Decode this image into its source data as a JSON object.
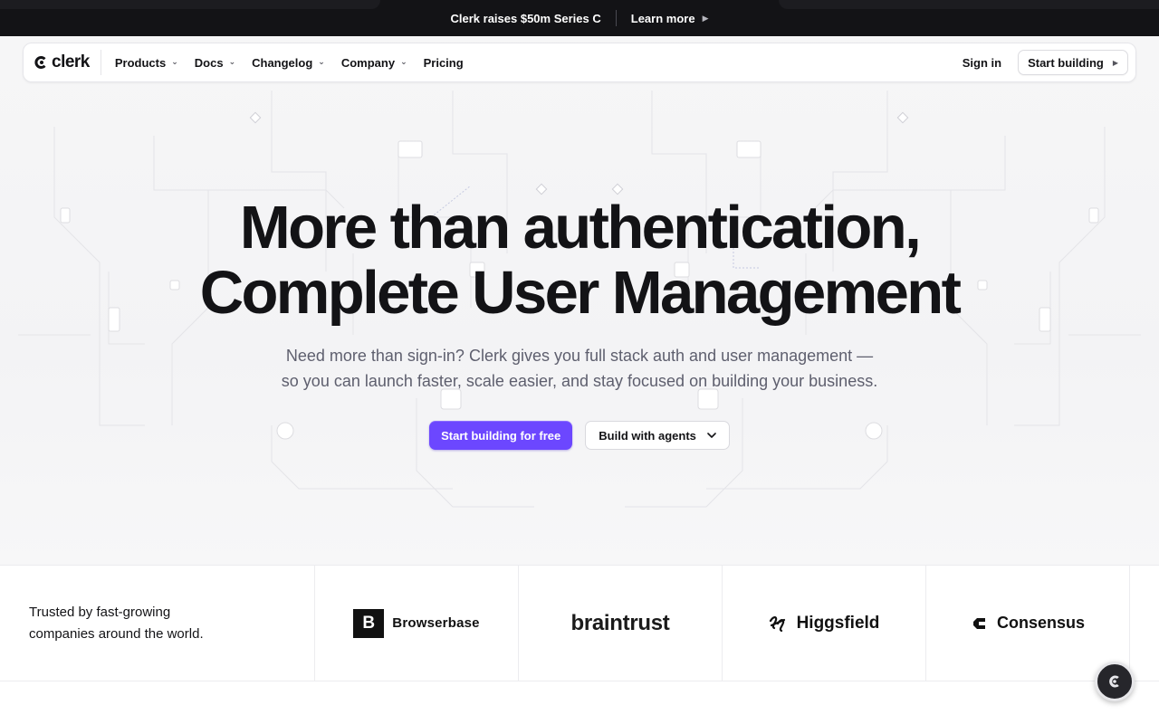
{
  "announcement": {
    "text": "Clerk raises $50m Series C",
    "link_label": "Learn more"
  },
  "nav": {
    "logo_text": "clerk",
    "items": [
      {
        "label": "Products",
        "has_dropdown": true
      },
      {
        "label": "Docs",
        "has_dropdown": true
      },
      {
        "label": "Changelog",
        "has_dropdown": true
      },
      {
        "label": "Company",
        "has_dropdown": true
      },
      {
        "label": "Pricing",
        "has_dropdown": false
      }
    ],
    "sign_in": "Sign in",
    "start_building": "Start building"
  },
  "hero": {
    "headline_line1": "More than authentication,",
    "headline_line2": "Complete User Management",
    "subtitle_line1": "Need more than sign-in? Clerk gives you full stack auth and user management —",
    "subtitle_line2": "so you can launch faster, scale easier, and stay focused on building your business.",
    "cta_primary": "Start building for free",
    "cta_secondary": "Build with agents"
  },
  "trust": {
    "text_line1": "Trusted by fast-growing",
    "text_line2": "companies around the world.",
    "logos": [
      {
        "mark": "B",
        "name": "Browserbase"
      },
      {
        "name": "braintrust"
      },
      {
        "name": "Higgsfield"
      },
      {
        "name": "Consensus"
      }
    ]
  },
  "colors": {
    "accent": "#6c47ff",
    "announcement_bg": "#131316",
    "text_primary": "#131316",
    "text_secondary": "#5e5f6e"
  },
  "icons": {
    "nav_dropdown": "chevron-down-icon",
    "start_building": "play-triangle-icon",
    "announcement_link": "play-triangle-icon",
    "fab": "clerk-help-icon"
  }
}
